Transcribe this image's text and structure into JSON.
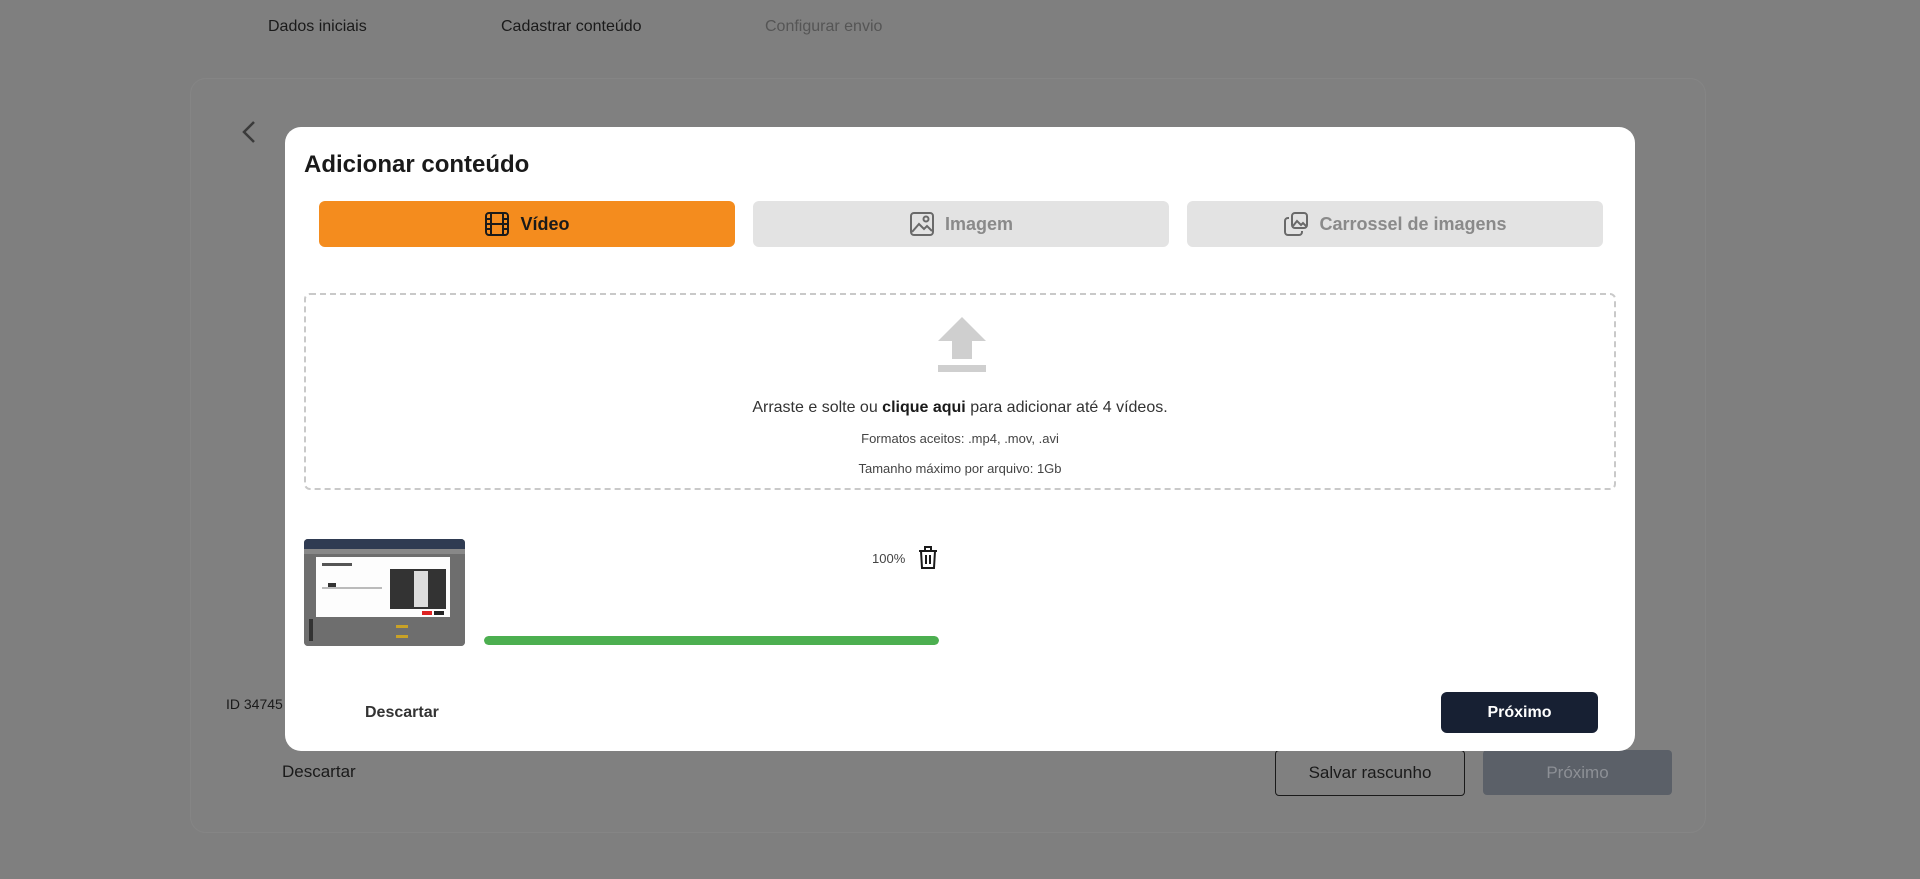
{
  "stepper": {
    "steps": [
      {
        "label": "Dados iniciais"
      },
      {
        "label": "Cadastrar conteúdo"
      },
      {
        "label": "Configurar envio"
      }
    ]
  },
  "background": {
    "id_label": "ID 34745",
    "discard_label": "Descartar",
    "save_draft_label": "Salvar rascunho",
    "next_label": "Próximo"
  },
  "modal": {
    "title": "Adicionar conteúdo",
    "tabs": [
      {
        "label": "Vídeo",
        "icon": "film-icon",
        "active": true
      },
      {
        "label": "Imagem",
        "icon": "image-icon",
        "active": false
      },
      {
        "label": "Carrossel de imagens",
        "icon": "images-stack-icon",
        "active": false
      }
    ],
    "dropzone": {
      "text_before": "Arraste e solte ou ",
      "link_text": "clique aqui",
      "text_after": " para adicionar até 4 vídeos.",
      "formats": "Formatos aceitos: .mp4, .mov, .avi",
      "max_size": "Tamanho máximo por arquivo: 1Gb"
    },
    "upload_item": {
      "percent_label": "100%",
      "progress": 1.0
    },
    "discard_label": "Descartar",
    "next_label": "Próximo"
  },
  "colors": {
    "accent": "#f48c1e",
    "primary_dark": "#172033",
    "progress": "#4caf50",
    "overlay": "#7f7f7f"
  }
}
